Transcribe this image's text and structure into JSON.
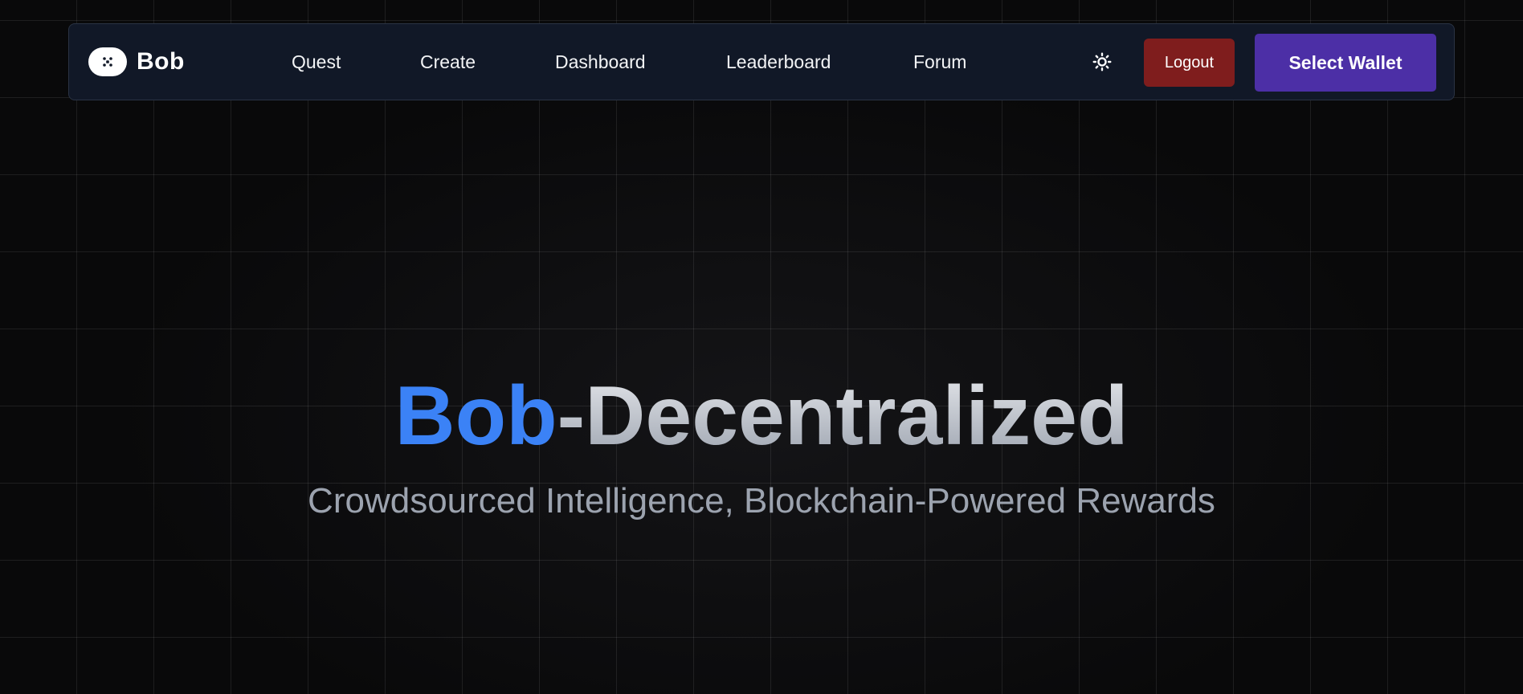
{
  "navbar": {
    "brand": {
      "logo_icon": "robot-face-icon",
      "name": "Bob"
    },
    "links": [
      "Quest",
      "Create",
      "Dashboard",
      "Leaderboard",
      "Forum"
    ],
    "theme_toggle_icon": "sun-icon",
    "logout_label": "Logout",
    "wallet_label": "Select Wallet"
  },
  "hero": {
    "title_accent": "Bob",
    "title_rest": "-Decentralized",
    "subtitle": "Crowdsourced Intelligence, Blockchain-Powered Rewards"
  },
  "colors": {
    "background": "#09090a",
    "navbar_bg": "#111827",
    "accent_blue": "#3b82f6",
    "logout_red": "#7f1d1d",
    "wallet_purple": "#4c2fa6",
    "subtitle_gray": "#9ca3af"
  }
}
